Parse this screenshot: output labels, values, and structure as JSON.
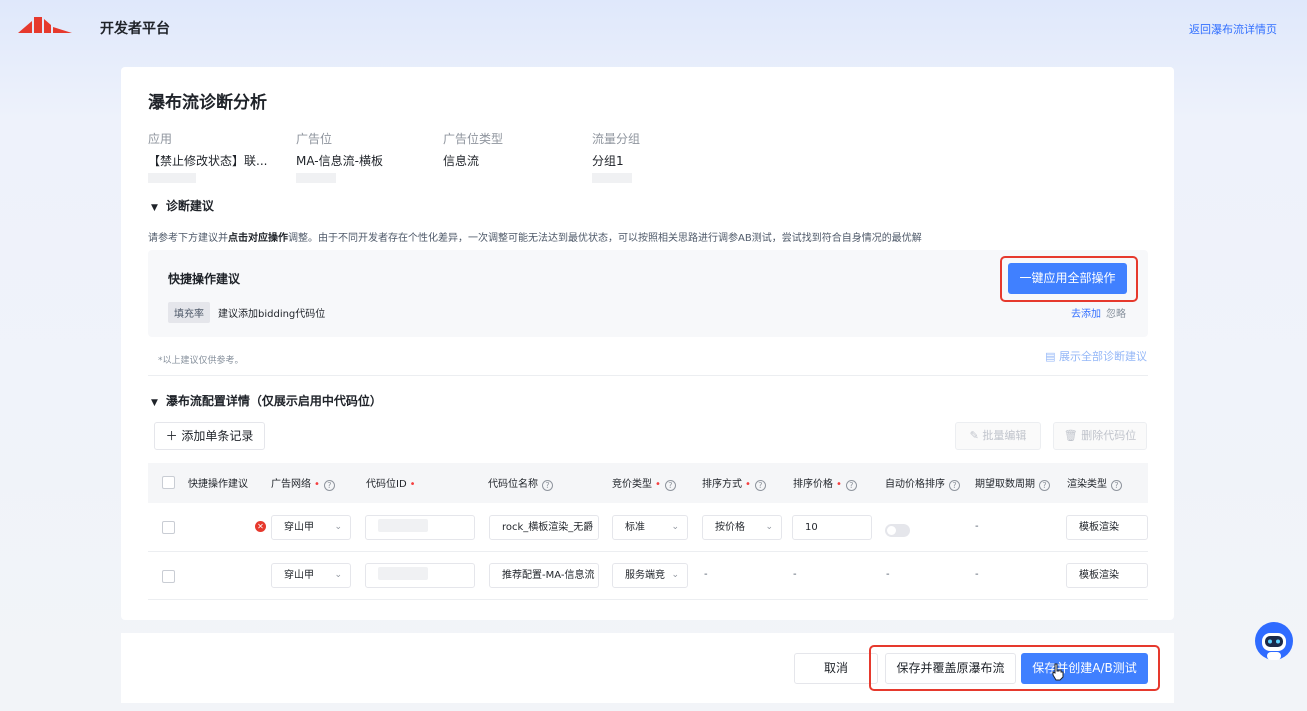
{
  "header": {
    "brand": "开发者平台",
    "back_link": "返回瀑布流详情页"
  },
  "page": {
    "title": "瀑布流诊断分析"
  },
  "info": [
    {
      "label": "应用",
      "value": "【禁止修改状态】联..."
    },
    {
      "label": "广告位",
      "value": "MA-信息流-横板"
    },
    {
      "label": "广告位类型",
      "value": "信息流"
    },
    {
      "label": "流量分组",
      "value": "分组1"
    }
  ],
  "diagnosis": {
    "title": "诊断建议",
    "hint_pre": "请参考下方建议并",
    "hint_bold": "点击对应操作",
    "hint_post": "调整。由于不同开发者存在个性化差异，一次调整可能无法达到最优状态，可以按照相关思路进行调参AB测试，尝试找到符合自身情况的最优解",
    "quick_title": "快捷操作建议",
    "apply_all": "一键应用全部操作",
    "tag": "填充率",
    "suggestion": "建议添加bidding代码位",
    "add_link": "去添加",
    "ignore_link": "忽略",
    "footnote": "*以上建议仅供参考。",
    "show_all": "展示全部诊断建议"
  },
  "config": {
    "title": "瀑布流配置详情（仅展示启用中代码位）",
    "add_record": "添加单条记录",
    "batch_edit": "批量编辑",
    "delete_slot": "删除代码位",
    "columns": [
      "快捷操作建议",
      "广告网络",
      "代码位ID",
      "代码位名称",
      "竞价类型",
      "排序方式",
      "排序价格",
      "自动价格排序",
      "期望取数周期",
      "渲染类型"
    ],
    "rows": [
      {
        "network": "穿山甲",
        "slot_name": "rock_横板渲染_无爵",
        "bid_type": "标准",
        "sort_method": "按价格",
        "sort_price": "10",
        "period": "-",
        "render": "模板渲染"
      },
      {
        "network": "穿山甲",
        "slot_name": "推荐配置-MA-信息流",
        "bid_type": "服务端竞",
        "sort_method": "-",
        "sort_price": "-",
        "auto_sort": "-",
        "period": "-",
        "render": "模板渲染"
      }
    ]
  },
  "footer": {
    "cancel": "取消",
    "save_cover": "保存并覆盖原瀑布流",
    "save_ab": "保存并创建A/B测试"
  },
  "icons": {
    "logo": "brand-logo",
    "robot": "assistant-robot-icon"
  },
  "colors": {
    "primary": "#4080ff",
    "highlight": "#e6392d",
    "link": "#3370ff"
  }
}
